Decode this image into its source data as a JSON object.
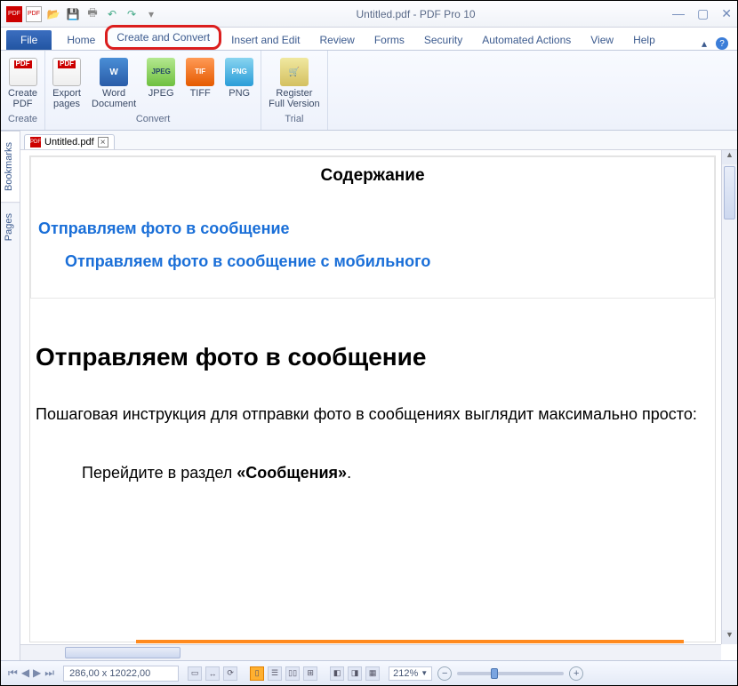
{
  "title": "Untitled.pdf - PDF Pro 10",
  "qat_icons": [
    "pdf-app-icon",
    "pdf-icon",
    "open-icon",
    "save-icon",
    "print-icon",
    "undo-icon",
    "redo-icon",
    "customize-icon"
  ],
  "tabs": {
    "file": "File",
    "items": [
      "Home",
      "Create and Convert",
      "Insert and Edit",
      "Review",
      "Forms",
      "Security",
      "Automated Actions",
      "View",
      "Help"
    ],
    "active_index": 1
  },
  "ribbon": {
    "groups": [
      {
        "label": "Create",
        "items": [
          {
            "label": "Create\nPDF",
            "icon": "pdf-ico"
          }
        ]
      },
      {
        "label": "Convert",
        "items": [
          {
            "label": "Export\npages",
            "icon": "pdf-ico"
          },
          {
            "label": "Word\nDocument",
            "icon": "word-ico",
            "badge": "W"
          },
          {
            "label": "JPEG",
            "icon": "jpeg-ico",
            "badge": "JPEG"
          },
          {
            "label": "TIFF",
            "icon": "tif-ico",
            "badge": "TIF"
          },
          {
            "label": "PNG",
            "icon": "png-ico",
            "badge": "PNG"
          }
        ]
      },
      {
        "label": "Trial",
        "items": [
          {
            "label": "Register\nFull Version",
            "icon": "reg-ico"
          }
        ]
      }
    ]
  },
  "sidetabs": [
    "Bookmarks",
    "Pages"
  ],
  "doctab": {
    "name": "Untitled.pdf"
  },
  "document": {
    "toc_title": "Содержание",
    "toc_l1": "Отправляем фото в сообщение",
    "toc_l2": "Отправляем фото в сообщение с мобильного",
    "h1": "Отправляем фото в сообщение",
    "para": "Пошаговая инструкция для отправки фото в сообщениях выглядит максимально просто:",
    "step_pre": "Перейдите в раздел ",
    "step_b": "«Сообщения»",
    "step_post": "."
  },
  "status": {
    "coords": "286,00 x 12022,00",
    "zoom": "212%"
  }
}
